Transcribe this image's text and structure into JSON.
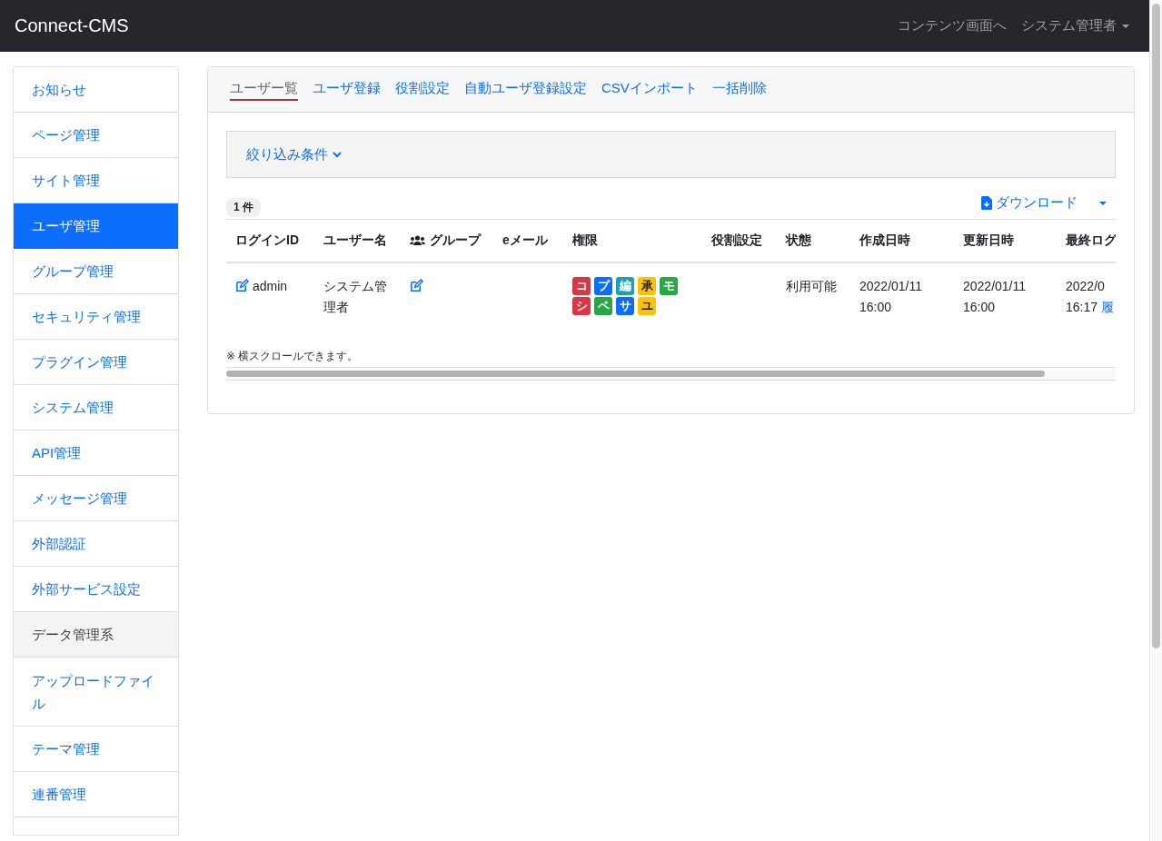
{
  "navbar": {
    "brand": "Connect-CMS",
    "links": [
      {
        "label": "コンテンツ画面へ",
        "kind": "link"
      },
      {
        "label": "システム管理者",
        "kind": "dropdown"
      }
    ]
  },
  "sidebar": {
    "items": [
      {
        "label": "お知らせ",
        "kind": "link",
        "selected": false
      },
      {
        "label": "ページ管理",
        "kind": "link",
        "selected": false
      },
      {
        "label": "サイト管理",
        "kind": "link",
        "selected": false
      },
      {
        "label": "ユーザ管理",
        "kind": "link",
        "selected": true
      },
      {
        "label": "グループ管理",
        "kind": "link",
        "selected": false
      },
      {
        "label": "セキュリティ管理",
        "kind": "link",
        "selected": false
      },
      {
        "label": "プラグイン管理",
        "kind": "link",
        "selected": false
      },
      {
        "label": "システム管理",
        "kind": "link",
        "selected": false
      },
      {
        "label": "API管理",
        "kind": "link",
        "selected": false
      },
      {
        "label": "メッセージ管理",
        "kind": "link",
        "selected": false
      },
      {
        "label": "外部認証",
        "kind": "link",
        "selected": false
      },
      {
        "label": "外部サービス設定",
        "kind": "link",
        "selected": false
      },
      {
        "label": "データ管理系",
        "kind": "header",
        "selected": false
      },
      {
        "label": "アップロードファイル",
        "kind": "link",
        "selected": false
      },
      {
        "label": "テーマ管理",
        "kind": "link",
        "selected": false
      },
      {
        "label": "連番管理",
        "kind": "link",
        "selected": false
      }
    ]
  },
  "tabs": [
    {
      "label": "ユーザー覧",
      "selected": true
    },
    {
      "label": "ユーザ登録",
      "selected": false
    },
    {
      "label": "役割設定",
      "selected": false
    },
    {
      "label": "自動ユーザ登録設定",
      "selected": false
    },
    {
      "label": "CSVインポート",
      "selected": false
    },
    {
      "label": "一括削除",
      "selected": false
    }
  ],
  "filter": {
    "label": "絞り込み条件",
    "expanded": false
  },
  "count": "1 件",
  "download": "ダウンロード",
  "table": {
    "columns": [
      "ログインID",
      "ユーザー名",
      "グループ",
      "eメール",
      "権限",
      "役割設定",
      "状態",
      "作成日時",
      "更新日時",
      "最終ログ"
    ],
    "rows": [
      {
        "login_id": "admin",
        "name": "システム管理者",
        "permissions": [
          {
            "label": "コ",
            "color": "#dc3545"
          },
          {
            "label": "プ",
            "color": "#0d6efd"
          },
          {
            "label": "編",
            "color": "#17a2b8"
          },
          {
            "label": "承",
            "color": "#ffc107"
          },
          {
            "label": "モ",
            "color": "#28a745"
          },
          {
            "label": "シ",
            "color": "#dc3545"
          },
          {
            "label": "ペ",
            "color": "#28a745"
          },
          {
            "label": "サ",
            "color": "#0d6efd"
          },
          {
            "label": "ユ",
            "color": "#ffc107"
          }
        ],
        "status": "利用可能",
        "created": "2022/01/11 16:00",
        "updated": "2022/01/11 16:00",
        "last_login": {
          "date": "2022/0",
          "time": "16:17",
          "link": "履"
        }
      }
    ]
  },
  "note": "※ 横スクロールできます。"
}
